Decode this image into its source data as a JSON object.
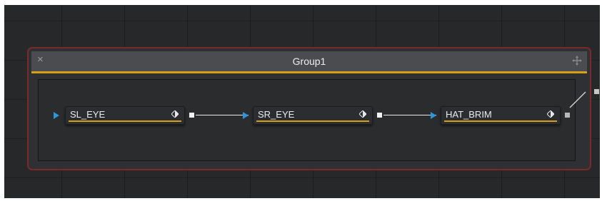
{
  "group": {
    "title": "Group1",
    "close_icon": "close-icon",
    "move_icon": "move-icon"
  },
  "tools": [
    {
      "name": "SL_EYE"
    },
    {
      "name": "SR_EYE"
    },
    {
      "name": "HAT_BRIM"
    }
  ],
  "colors": {
    "canvas": "#26282a",
    "group_border": "#7a2b28",
    "accent": "#d6a215",
    "input_arrow": "#2e95d8"
  }
}
